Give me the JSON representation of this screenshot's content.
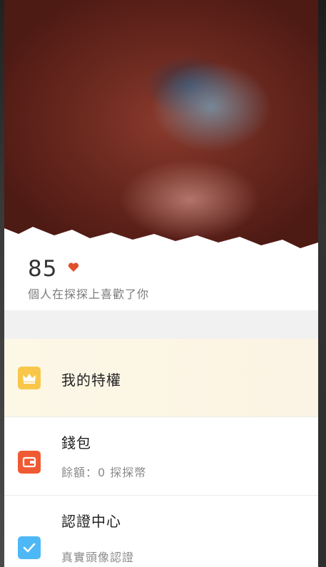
{
  "profile": {
    "likes_count": "85",
    "likes_caption": "個人在探探上喜歡了你"
  },
  "menu": {
    "privilege": {
      "title": "我的特權",
      "icon": "crown-icon"
    },
    "wallet": {
      "title": "錢包",
      "subtitle": "餘額：0 探探幣",
      "icon": "wallet-icon"
    },
    "verify": {
      "title": "認證中心",
      "subtitle": "真實頭像認證",
      "icon": "check-icon"
    }
  },
  "colors": {
    "privilege_icon": "#f8c74a",
    "wallet_icon": "#f05a33",
    "verify_icon": "#4db8f5",
    "heart": "#e0502a"
  }
}
